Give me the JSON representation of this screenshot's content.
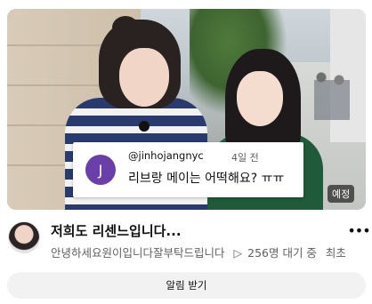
{
  "comment": {
    "avatar_letter": "J",
    "avatar_color": "#6a3fa8",
    "username": "@jinhojangnyc",
    "time": "4일 전",
    "text": "리브랑 메이는 어떡해요? ㅠㅠ"
  },
  "thumbnail": {
    "badge": "예정"
  },
  "video": {
    "title": "저희도 리센느입니다...",
    "channel": "안녕하세요원이입니다잘부탁드립니다",
    "waiting_icon": "▷",
    "waiting": "256명 대기 중",
    "extra": "최초"
  },
  "more_icon": "•••",
  "notify_button": "알림 받기"
}
